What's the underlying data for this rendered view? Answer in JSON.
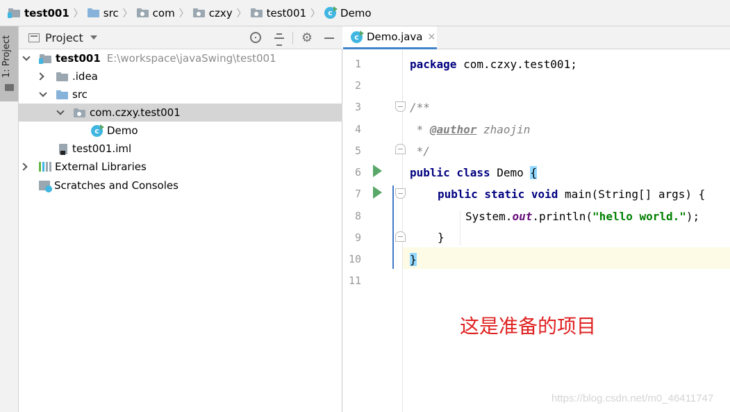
{
  "breadcrumb": [
    "test001",
    "src",
    "com",
    "czxy",
    "test001",
    "Demo"
  ],
  "tool_window_label": "1: Project",
  "project_panel": {
    "title": "Project",
    "tree": [
      {
        "label": "test001",
        "path": "E:\\workspace\\javaSwing\\test001",
        "expanded": true
      },
      {
        "label": ".idea",
        "expanded": false
      },
      {
        "label": "src",
        "expanded": true
      },
      {
        "label": "com.czxy.test001",
        "expanded": true,
        "selected": true
      },
      {
        "label": "Demo"
      },
      {
        "label": "test001.iml"
      },
      {
        "label": "External Libraries",
        "expanded": false
      },
      {
        "label": "Scratches and Consoles"
      }
    ]
  },
  "editor": {
    "tab_label": "Demo.java",
    "tab_close": "×",
    "line_numbers": [
      "1",
      "2",
      "3",
      "4",
      "5",
      "6",
      "7",
      "8",
      "9",
      "10",
      "11"
    ],
    "code": {
      "l1_kw": "package",
      "l1_rest": " com.czxy.test001;",
      "l3": "/**",
      "l4_star": " * ",
      "l4_tag": "@author",
      "l4_name": " zhaojin",
      "l5": " */",
      "l6_kw": "public class",
      "l6_name": " Demo ",
      "l6_brace": "{",
      "l7_kw": "public static void",
      "l7_rest": " main(String[] args) {",
      "l8_a": "System.",
      "l8_field": "out",
      "l8_b": ".println(",
      "l8_str": "\"hello world.\"",
      "l8_c": ");",
      "l9": "}",
      "l10": "}"
    }
  },
  "annotation": "这是准备的项目",
  "watermark": "https://blog.csdn.net/m0_46411747",
  "colors": {
    "keyword": "#000080",
    "string": "#008000",
    "comment": "#808080",
    "annotation": "#e02020",
    "selection": "#d5d5d5",
    "current_line": "#fdfbe6"
  }
}
